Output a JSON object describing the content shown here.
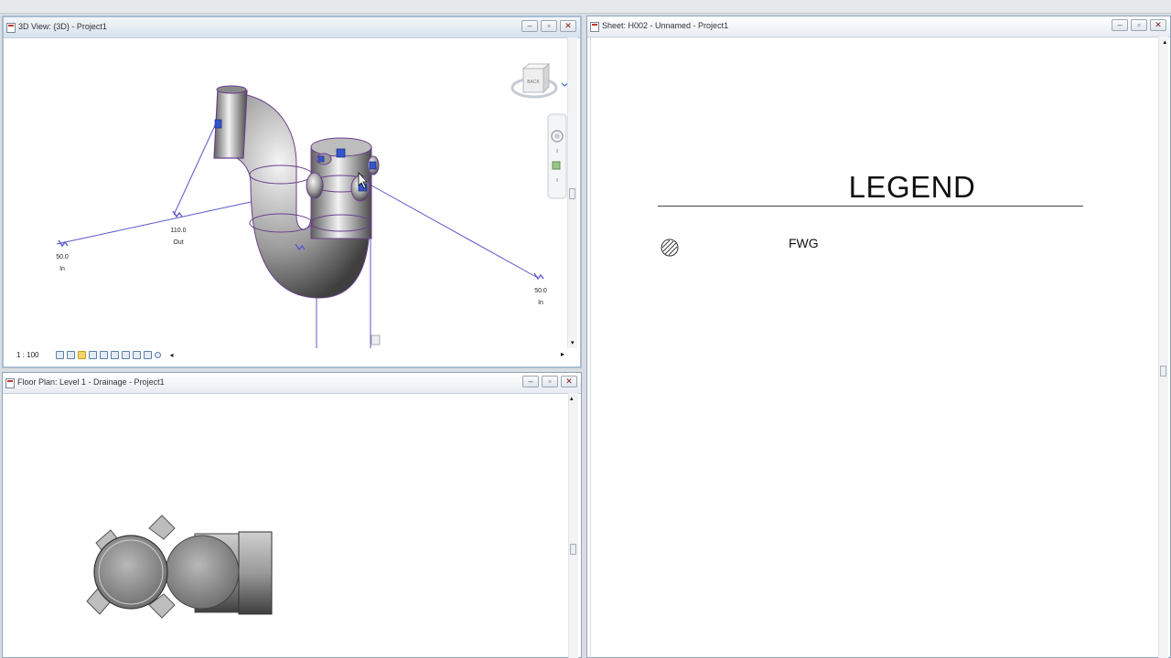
{
  "windows": {
    "view3d": {
      "title": "3D View: {3D} - Project1",
      "scale": "1 : 100",
      "connectors": [
        {
          "value": "50.0",
          "flow": "In"
        },
        {
          "value": "110.0",
          "flow": "Out"
        },
        {
          "value": "50.0",
          "flow": "In"
        }
      ],
      "viewcube_face": "BACK"
    },
    "floorplan": {
      "title": "Floor Plan: Level 1 - Drainage - Project1"
    },
    "sheet": {
      "title": "Sheet: H002 - Unnamed - Project1",
      "legend_title": "LEGEND",
      "legend_item_label": "FWG"
    }
  },
  "window_buttons": {
    "minimize": "–",
    "restore": "▫",
    "close": "✕"
  },
  "colors": {
    "pipe_outline": "#6b3f8e",
    "connector_line": "#5a57c9",
    "titlebar": "#dbe4ee"
  }
}
